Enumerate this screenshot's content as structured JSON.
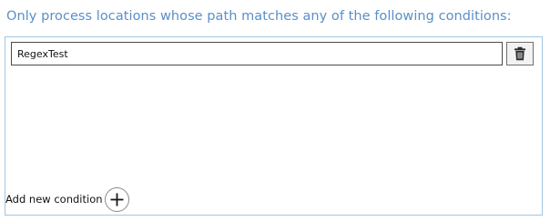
{
  "header": {
    "text": "Only process locations whose path matches any of the following conditions:"
  },
  "conditions": [
    {
      "value": "RegexTest"
    }
  ],
  "actions": {
    "add_label": "Add new condition"
  },
  "icons": {
    "delete": "trash-icon",
    "add": "plus-icon"
  },
  "colors": {
    "header_text": "#5a8fc8",
    "panel_border": "#9fc6e2"
  }
}
